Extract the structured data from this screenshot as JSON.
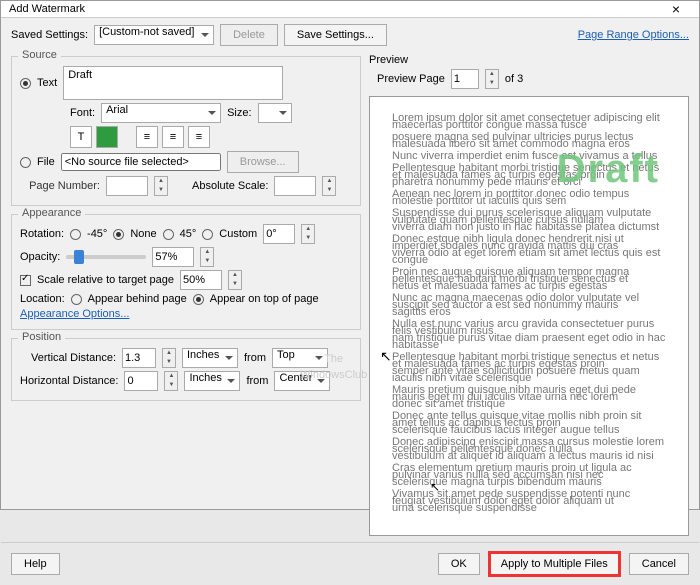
{
  "title": "Add Watermark",
  "toolbar": {
    "saved_label": "Saved Settings:",
    "saved_value": "[Custom-not saved]",
    "delete": "Delete",
    "save": "Save Settings...",
    "page_range": "Page Range Options..."
  },
  "source": {
    "title": "Source",
    "text_label": "Text",
    "text_value": "Draft",
    "font_label": "Font:",
    "font_value": "Arial",
    "size_label": "Size:",
    "size_value": "",
    "file_label": "File",
    "file_value": "<No source file selected>",
    "browse": "Browse...",
    "page_num_label": "Page Number:",
    "page_num_value": "",
    "abs_scale_label": "Absolute Scale:",
    "abs_scale_value": ""
  },
  "appearance": {
    "title": "Appearance",
    "rotation_label": "Rotation:",
    "rot_neg45": "-45°",
    "rot_none": "None",
    "rot_45": "45°",
    "rot_custom": "Custom",
    "rot_custom_val": "0°",
    "opacity_label": "Opacity:",
    "opacity_val": "57%",
    "scale_label": "Scale relative to target page",
    "scale_val": "50%",
    "location_label": "Location:",
    "behind": "Appear behind page",
    "ontop": "Appear on top of page",
    "options_link": "Appearance Options..."
  },
  "position": {
    "title": "Position",
    "vlabel": "Vertical Distance:",
    "vval": "1.3",
    "vunit": "Inches",
    "vfrom_label": "from",
    "vfrom": "Top",
    "hlabel": "Horizontal Distance:",
    "hval": "0",
    "hunit": "Inches",
    "hfrom_label": "from",
    "hfrom": "Center"
  },
  "preview": {
    "title": "Preview",
    "page_label": "Preview Page",
    "page_val": "1",
    "of_label": "of 3",
    "watermark": "Draft"
  },
  "buttons": {
    "help": "Help",
    "ok": "OK",
    "apply": "Apply to Multiple Files",
    "cancel": "Cancel"
  },
  "site_watermark1": "The",
  "site_watermark2": "WindowsClub"
}
